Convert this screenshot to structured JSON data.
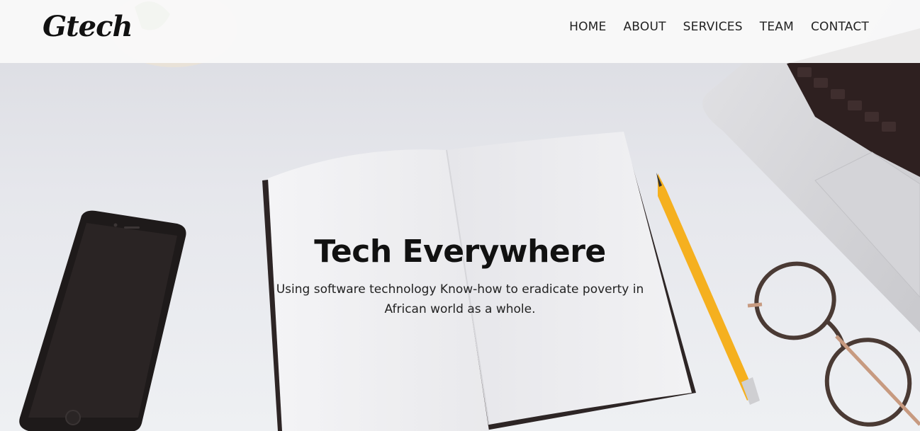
{
  "brand": {
    "logo_text": "Gtech"
  },
  "nav": {
    "items": [
      {
        "label": "HOME"
      },
      {
        "label": "ABOUT"
      },
      {
        "label": "SERVICES"
      },
      {
        "label": "TEAM"
      },
      {
        "label": "CONTACT"
      }
    ]
  },
  "hero": {
    "title": "Tech Everywhere",
    "subtitle": "Using software technology Know-how to eradicate poverty in African world as a whole."
  },
  "colors": {
    "text": "#111111",
    "navbar_bg": "#fafafa",
    "pencil": "#f5b01f"
  }
}
